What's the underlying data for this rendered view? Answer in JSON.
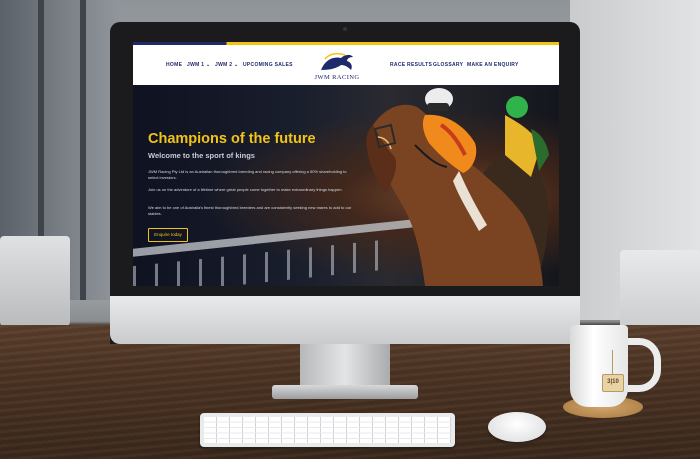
{
  "nav": {
    "left": [
      "HOME",
      "JWM 1",
      "JWM 2",
      "UPCOMING SALES"
    ],
    "right": [
      "RACE RESULTS",
      "GLOSSARY",
      "MAKE AN ENQUIRY"
    ],
    "dropdown_indicator": "⌄"
  },
  "logo": {
    "text": "JWM RACING"
  },
  "hero": {
    "title": "Champions of the future",
    "subtitle": "Welcome to the sport of kings",
    "paragraphs": [
      "JWM Racing Pty Ltd is an Australian thoroughbred breeding and racing company offering a 50% shareholding to select investors.",
      "Join us on the adventure of a lifetime where great people come together to make extraordinary things happen.",
      "We aim to be one of Australia's finest thoroughbred breeders and are consistently seeking new mares to add to our stables."
    ],
    "cta": "Enquire today"
  },
  "teabag": {
    "label": "3|10"
  },
  "colors": {
    "navy": "#1f2a6b",
    "gold": "#f2c418"
  }
}
